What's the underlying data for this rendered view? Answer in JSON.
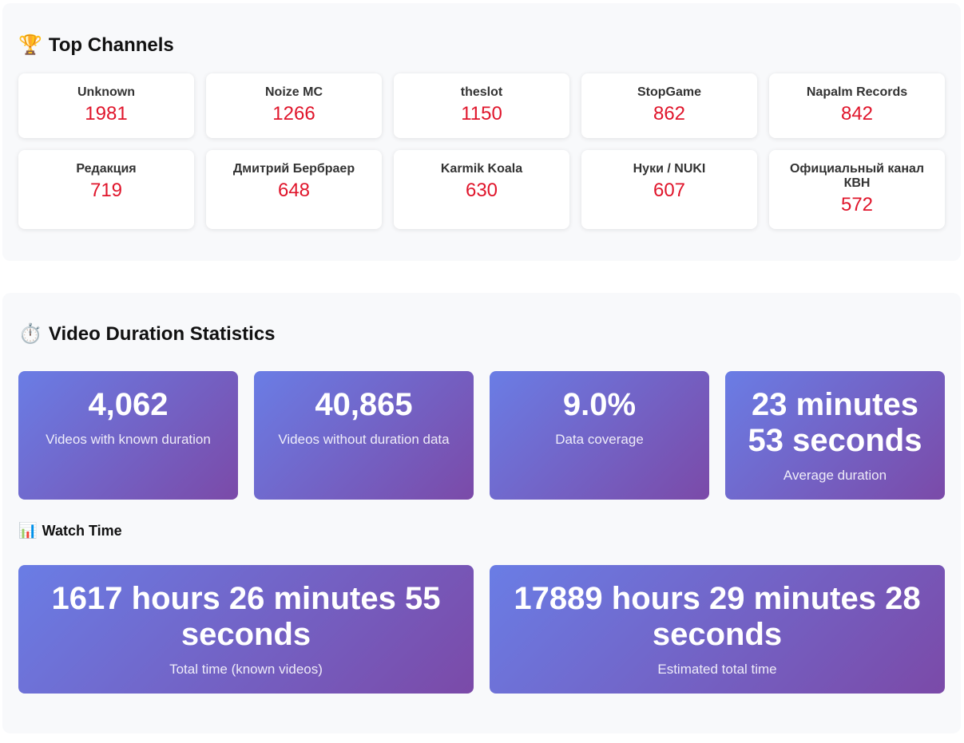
{
  "top_channels": {
    "emoji": "🏆",
    "title": "Top Channels",
    "channels": [
      {
        "name": "Unknown",
        "count": "1981"
      },
      {
        "name": "Noize MC",
        "count": "1266"
      },
      {
        "name": "theslot",
        "count": "1150"
      },
      {
        "name": "StopGame",
        "count": "862"
      },
      {
        "name": "Napalm Records",
        "count": "842"
      },
      {
        "name": "Редакция",
        "count": "719"
      },
      {
        "name": "Дмитрий Бербраер",
        "count": "648"
      },
      {
        "name": "Karmik Koala",
        "count": "630"
      },
      {
        "name": "Нуки / NUKI",
        "count": "607"
      },
      {
        "name": "Официальный канал КВН",
        "count": "572"
      }
    ]
  },
  "duration_stats": {
    "emoji": "⏱️",
    "title": "Video Duration Statistics",
    "cards": [
      {
        "value": "4,062",
        "label": "Videos with known duration"
      },
      {
        "value": "40,865",
        "label": "Videos without duration data"
      },
      {
        "value": "9.0%",
        "label": "Data coverage"
      },
      {
        "value": "23 minutes 53 seconds",
        "label": "Average duration"
      }
    ]
  },
  "watch_time": {
    "emoji": "📊",
    "title": "Watch Time",
    "cards": [
      {
        "value": "1617 hours 26 minutes 55 seconds",
        "label": "Total time (known videos)"
      },
      {
        "value": "17889 hours 29 minutes 28 seconds",
        "label": "Estimated total time"
      }
    ]
  },
  "colors": {
    "count_red": "#e0152b",
    "gradient_start": "#6a7de5",
    "gradient_end": "#7b4aa8",
    "section_bg": "#f8f9fb"
  }
}
